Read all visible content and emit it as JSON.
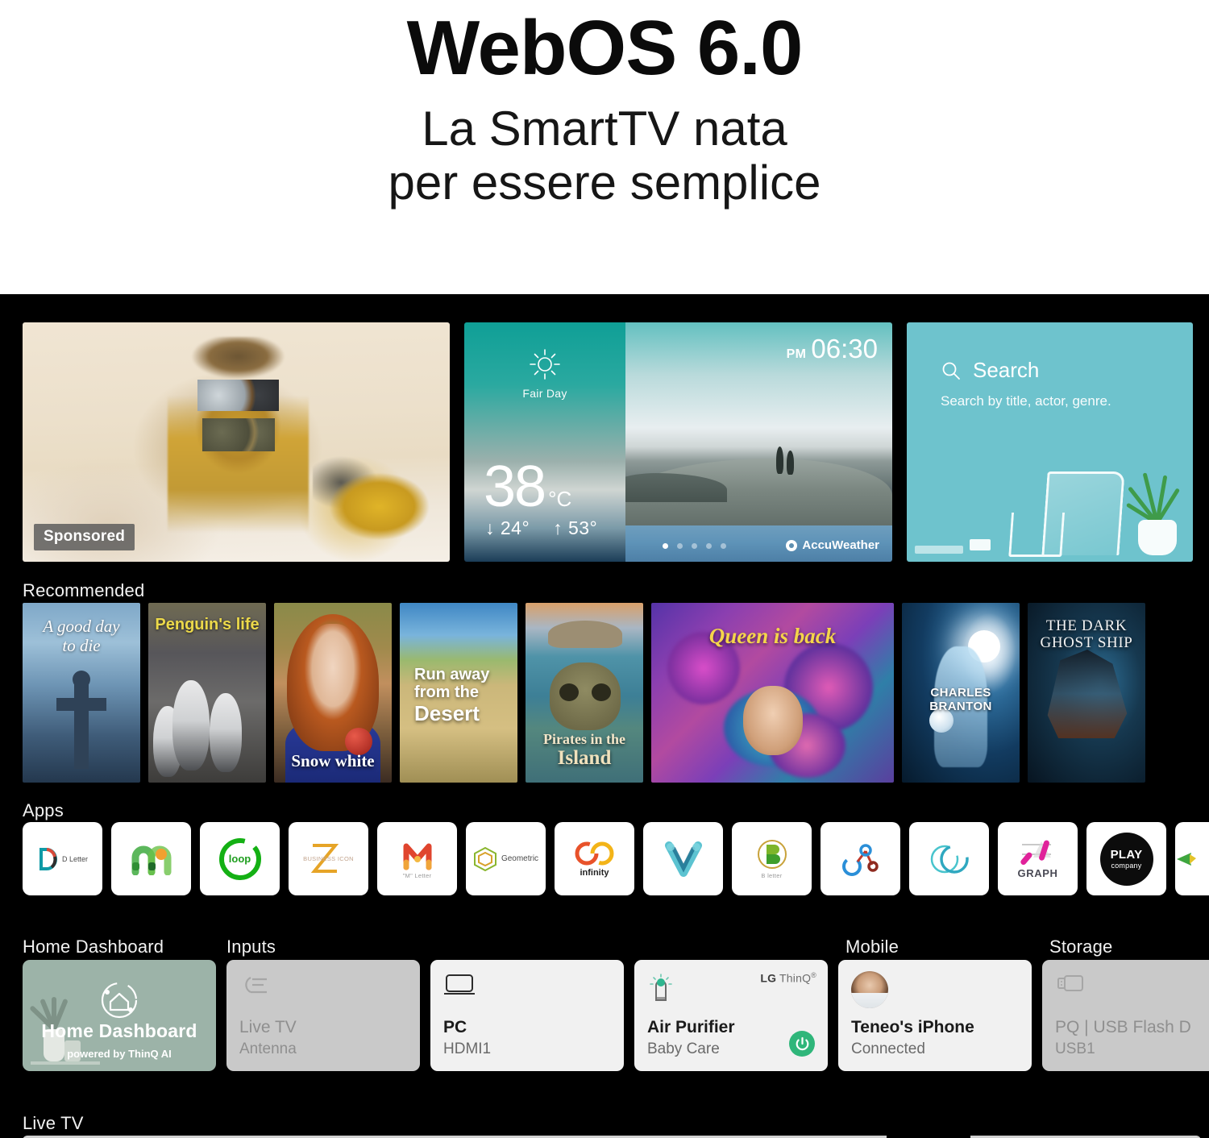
{
  "header": {
    "title": "WebOS 6.0",
    "subtitle_line1": "La SmartTV nata",
    "subtitle_line2": "per essere semplice"
  },
  "hero": {
    "sponsored_badge": "Sponsored"
  },
  "weather": {
    "condition": "Fair Day",
    "temperature": "38",
    "unit": "°C",
    "low": "↓ 24°",
    "high": "↑ 53°",
    "meridiem": "PM",
    "time": "06:30",
    "provider": "AccuWeather",
    "page_dots": 5,
    "active_dot": 1
  },
  "search": {
    "label": "Search",
    "sublabel": "Search by title, actor, genre.",
    "icon": "search-icon",
    "accent": "#6ec3cd"
  },
  "recommended": {
    "label": "Recommended",
    "tiles": [
      {
        "title_top": "A good day",
        "title_bottom": "to die",
        "style": "t-goodday"
      },
      {
        "title_top": "Penguin's life",
        "title_bottom": "",
        "style": "t-penguin"
      },
      {
        "title_top": "",
        "title_bottom": "Snow white",
        "style": "t-snow"
      },
      {
        "title_top": "Run away\nfrom the\nDesert",
        "title_bottom": "",
        "style": "t-desert"
      },
      {
        "title_top": "",
        "title_bottom": "Pirates in the\nIsland",
        "style": "t-pirates"
      },
      {
        "title_top": "Queen is back",
        "title_bottom": "",
        "style": "t-queen"
      },
      {
        "title_top": "",
        "title_bottom": "CHARLES BRANTON",
        "style": "t-charles"
      },
      {
        "title_top": "THE DARK\nGHOST SHIP",
        "title_bottom": "",
        "style": "t-ghost"
      }
    ]
  },
  "apps": {
    "label": "Apps",
    "items": [
      {
        "name": "d-letter-app-icon",
        "text": "D Letter",
        "kind": "d-letter"
      },
      {
        "name": "m-logo-app-icon",
        "text": "",
        "kind": "m-logo"
      },
      {
        "name": "loop-app-icon",
        "text": "loop",
        "kind": "loop"
      },
      {
        "name": "business-icon-app-icon",
        "text": "BUSINESS ICON",
        "kind": "z-business"
      },
      {
        "name": "m-letter-app-icon",
        "text": "\"M\" Letter",
        "kind": "m-letter"
      },
      {
        "name": "geometric-app-icon",
        "text": "Geometric",
        "kind": "geometric"
      },
      {
        "name": "infinity-app-icon",
        "text": "infinity",
        "kind": "infinity"
      },
      {
        "name": "v-shape-app-icon",
        "text": "",
        "kind": "v-shape"
      },
      {
        "name": "b-letter-app-icon",
        "text": "B letter",
        "kind": "b-letter"
      },
      {
        "name": "network-app-icon",
        "text": "",
        "kind": "network"
      },
      {
        "name": "circles-app-icon",
        "text": "",
        "kind": "circles"
      },
      {
        "name": "graph-app-icon",
        "text": "GRAPH",
        "kind": "graph"
      },
      {
        "name": "play-company-app-icon",
        "text": "PLAY",
        "text2": "company",
        "kind": "play"
      },
      {
        "name": "partial-app-icon",
        "text": "",
        "kind": "partial"
      }
    ]
  },
  "dashboard": {
    "labels": {
      "home": "Home Dashboard",
      "inputs": "Inputs",
      "mobile": "Mobile",
      "storage": "Storage"
    },
    "cards": [
      {
        "name": "home-dashboard-card",
        "title": "Home Dashboard",
        "sub": "powered by ThinQ AI",
        "kind": "home"
      },
      {
        "name": "live-tv-input-card",
        "title": "Live TV",
        "sub": "Antenna",
        "kind": "dim",
        "icon": "antenna-icon"
      },
      {
        "name": "pc-input-card",
        "title": "PC",
        "sub": "HDMI1",
        "kind": "light",
        "icon": "monitor-icon"
      },
      {
        "name": "air-purifier-card",
        "title": "Air Purifier",
        "sub": "Baby Care",
        "kind": "light",
        "icon": "air-purifier-icon",
        "brand": "ThinQ",
        "brand_prefix": "LG",
        "power": true
      },
      {
        "name": "mobile-iphone-card",
        "title": "Teneo's iPhone",
        "sub": "Connected",
        "kind": "light",
        "icon": "avatar"
      },
      {
        "name": "usb-storage-card",
        "title": "PQ | USB Flash D",
        "sub": "USB1",
        "kind": "dim",
        "icon": "usb-icon"
      }
    ]
  },
  "footer": {
    "live_tv_label": "Live TV"
  }
}
